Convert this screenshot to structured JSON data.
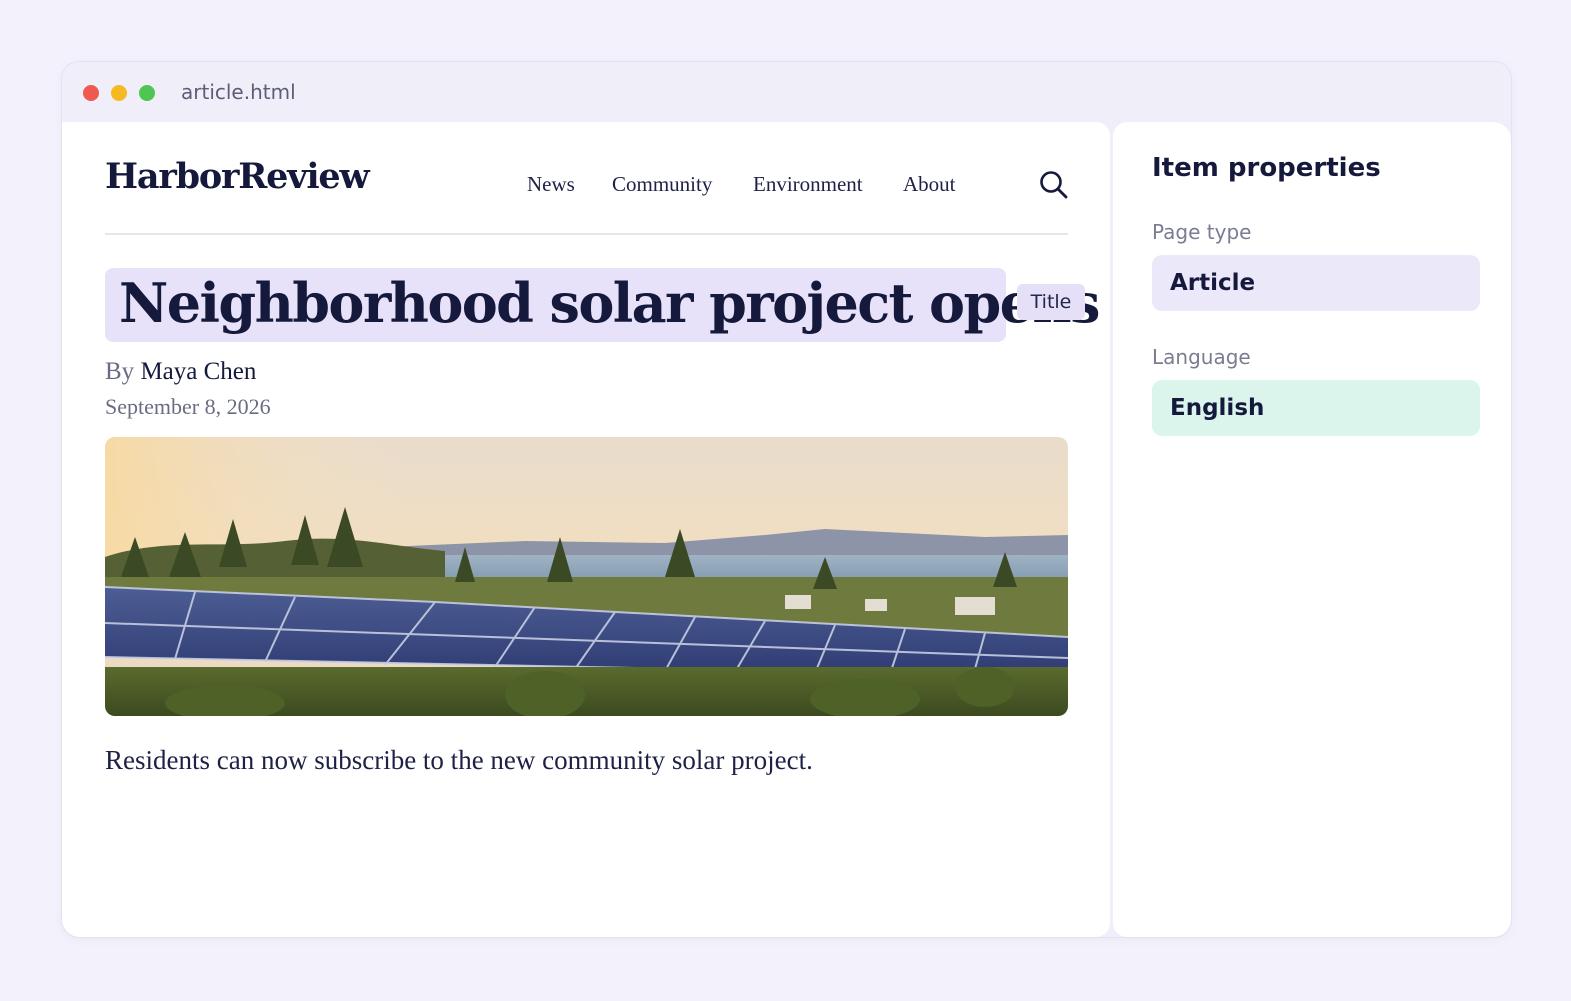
{
  "window": {
    "filename": "article.html"
  },
  "site": {
    "logo": "HarborReview",
    "nav": [
      "News",
      "Community",
      "Environment",
      "About"
    ],
    "search_icon": "search-icon"
  },
  "article": {
    "headline": "Neighborhood solar project opens",
    "headline_tag": "Title",
    "byline_prefix": "By",
    "author": "Maya Chen",
    "date": "September 8, 2026",
    "lede": "Residents can now subscribe to the new community solar project."
  },
  "properties": {
    "title": "Item properties",
    "page_type_label": "Page type",
    "page_type_value": "Article",
    "language_label": "Language",
    "language_value": "English"
  },
  "colors": {
    "highlight_purple": "#e7e2fa",
    "field_purple": "#ebe8fa",
    "field_mint": "#dcf5ec",
    "text_dark": "#151a3d"
  }
}
